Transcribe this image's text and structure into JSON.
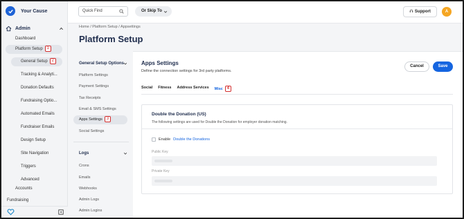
{
  "brand": {
    "name": "Your Cause"
  },
  "sidebar": {
    "section_label": "Admin",
    "items": [
      {
        "label": "Dashboard"
      },
      {
        "label": "Platform Setup",
        "step": "1"
      },
      {
        "label": "General Setup",
        "step": "2"
      },
      {
        "label": "Tracking & Analyti..."
      },
      {
        "label": "Donation Defaults"
      },
      {
        "label": "Fundraising Optio..."
      },
      {
        "label": "Automated Emails"
      },
      {
        "label": "Fundraiser Emails"
      },
      {
        "label": "Design Setup"
      },
      {
        "label": "Site Navigation"
      },
      {
        "label": "Triggers"
      },
      {
        "label": "Advanced"
      },
      {
        "label": "Accounts"
      },
      {
        "label": "Fundraising"
      }
    ]
  },
  "header": {
    "quickfind_placeholder": "Quick Find",
    "skip_to_label": "Or Skip To",
    "support_label": "Support",
    "avatar_initial": "A"
  },
  "breadcrumb": {
    "items": [
      "Home",
      "Platform Setup",
      "Appsettings"
    ]
  },
  "page_title": "Platform Setup",
  "subnav": {
    "group1_title": "General Setup Options",
    "group1_items": [
      {
        "label": "Platform Settings"
      },
      {
        "label": "Payment Settings"
      },
      {
        "label": "Tax Receipts"
      },
      {
        "label": "Email & SMS Settings"
      },
      {
        "label": "Apps Settings",
        "step": "3"
      },
      {
        "label": "Social Settings"
      }
    ],
    "group2_title": "Logs",
    "group2_items": [
      {
        "label": "Crons"
      },
      {
        "label": "Emails"
      },
      {
        "label": "Webhooks"
      },
      {
        "label": "Admin Logs"
      },
      {
        "label": "Admin Logins"
      }
    ]
  },
  "main": {
    "title": "Apps Settings",
    "description": "Define the connection settings for 3rd party platforms.",
    "cancel_label": "Cancel",
    "save_label": "Save",
    "tabs": [
      {
        "label": "Social"
      },
      {
        "label": "Fitness"
      },
      {
        "label": "Address Services"
      },
      {
        "label": "Misc",
        "step": "4"
      }
    ],
    "card": {
      "title": "Double the Donation (US)",
      "description": "The following settings are used for Double the Donation for employer donation matching.",
      "enable_prefix": "Enable",
      "enable_link": "Double the Donations",
      "public_key_label": "Public Key",
      "private_key_label": "Private Key"
    }
  },
  "colors": {
    "accent": "#1565e0",
    "brand": "#1e63d6",
    "avatar": "#f5a623",
    "step_marker": "#d32f2f"
  }
}
